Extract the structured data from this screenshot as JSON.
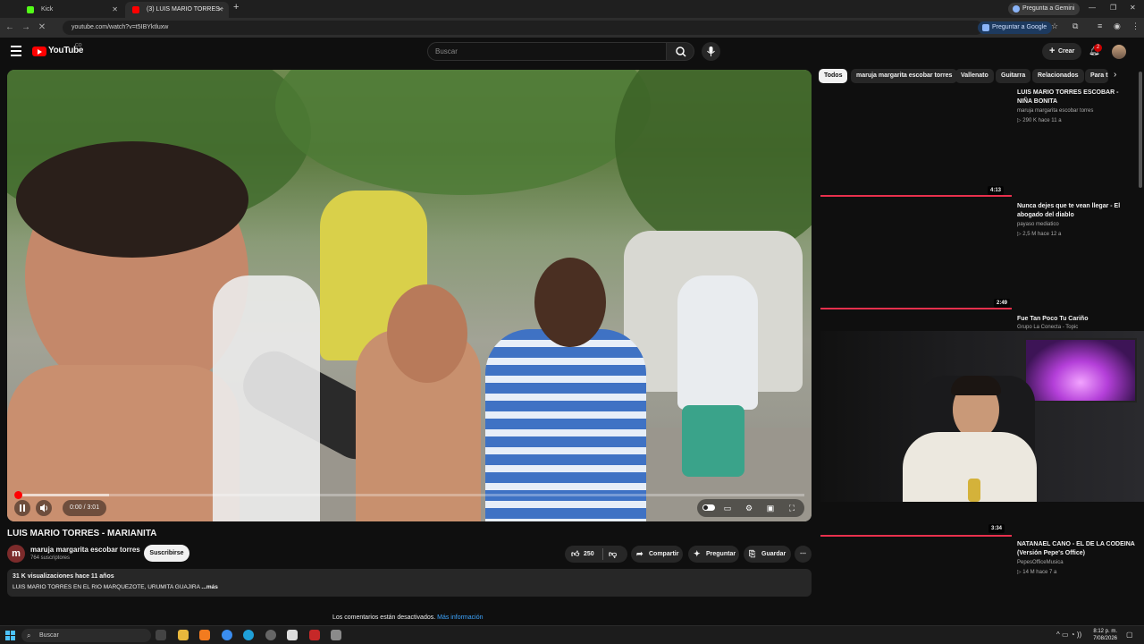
{
  "browser": {
    "tabs": [
      {
        "label": "Kick"
      },
      {
        "label": "(3) LUIS MARIO TORRES - M"
      }
    ],
    "new_tab": "+",
    "url": "youtube.com/watch?v=t5IBYktluxw",
    "gemini_button": "Pregunta a Gemini",
    "google_button": "Preguntar a Google"
  },
  "youtube": {
    "logo_text": "YouTube",
    "logo_country": "CO",
    "search_placeholder": "Buscar",
    "create_label": "Crear",
    "notif_count": "2"
  },
  "video": {
    "time": "0:00 / 3:01",
    "progress_fraction": 0.0,
    "buffer_fraction": 0.12
  },
  "watch": {
    "title": "LUIS MARIO TORRES - MARIANITA",
    "channel_initial": "m",
    "channel_name": "maruja margarita escobar torres",
    "subscribers": "764 suscriptores",
    "subscribe_label": "Suscribirse",
    "likes": "250",
    "share_label": "Compartir",
    "ask_label": "Preguntar",
    "save_label": "Guardar",
    "desc_meta": "31 K visualizaciones  hace 11 años",
    "desc_text": "LUIS MARIO TORRES EN EL RIO MARQUEZOTE, URUMITA GUAJIRA",
    "desc_more": "...más",
    "comments_off": "Los comentarios están desactivados.",
    "comments_link": "Más información"
  },
  "chips": [
    {
      "label": "Todos"
    },
    {
      "label": "maruja margarita escobar torres"
    },
    {
      "label": "Vallenato"
    },
    {
      "label": "Guitarra"
    },
    {
      "label": "Relacionados"
    },
    {
      "label": "Para t"
    }
  ],
  "recommendations": [
    {
      "title": "LUIS MARIO TORRES ESCOBAR - NIÑA BONITA",
      "channel": "maruja margarita escobar torres",
      "meta": "▷ 290 K  hace 11 a",
      "duration": "4:13"
    },
    {
      "title": "Nunca dejes que te vean llegar - El abogado del diablo",
      "channel": "payaso mediatico",
      "meta": "▷ 2,5 M  hace 12 a",
      "duration": "2:49"
    },
    {
      "title": "Fue Tan Poco Tu Cariño",
      "channel": "Grupo La Conecta - Topic",
      "meta": "",
      "duration": "3:34"
    },
    {
      "title": "NATANAEL CANO - EL DE LA CODEINA (Versión Pepe's Office)",
      "channel": "PepesOfficeMusica",
      "meta": "▷ 14 M  hace 7 a",
      "duration": ""
    }
  ],
  "taskbar": {
    "search_label": "Buscar",
    "time": "8:12 p. m.",
    "date": "7/08/2026"
  },
  "colors": {
    "accent_red": "#ff0000",
    "progress_red": "#e8304d",
    "background": "#0f0f0f"
  }
}
